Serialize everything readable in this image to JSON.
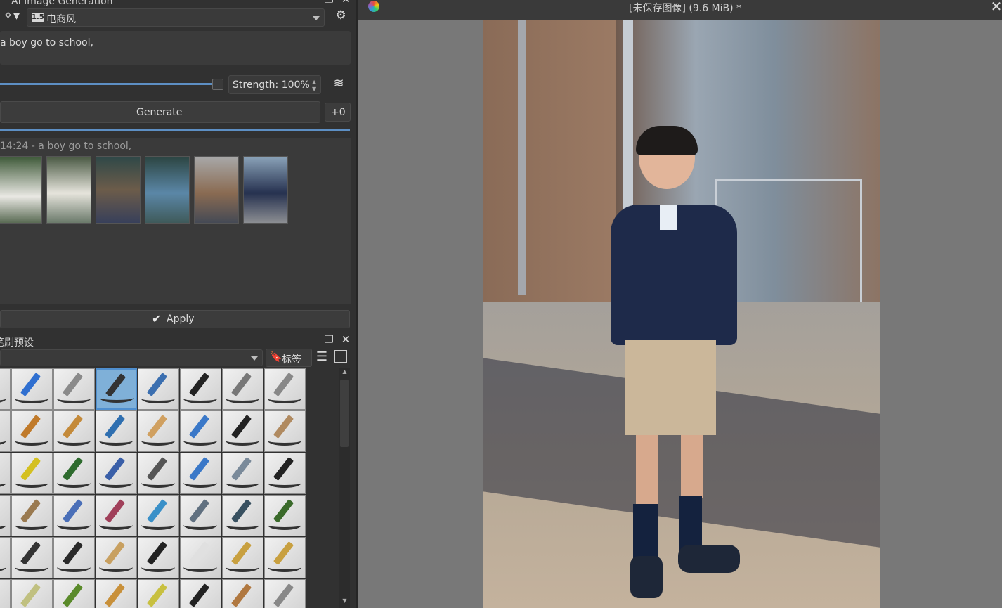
{
  "ai_panel": {
    "title": "AI Image Generation",
    "style_badge": "1.5",
    "style_name": "电商风",
    "prompt": "a boy go to school,",
    "strength_label": "Strength: 100%",
    "generate_label": "Generate",
    "queue_badge": "+0",
    "history_caption": "14:24 - a boy go to school,",
    "apply_label": "Apply"
  },
  "brush_panel": {
    "title": "笔刷预设",
    "tag_label": "标签"
  },
  "document": {
    "title": "[未保存图像]  (9.6 MiB) *"
  },
  "colors": {
    "accent": "#5d8fc4",
    "panel": "#313131",
    "canvas_bg": "#787878"
  }
}
